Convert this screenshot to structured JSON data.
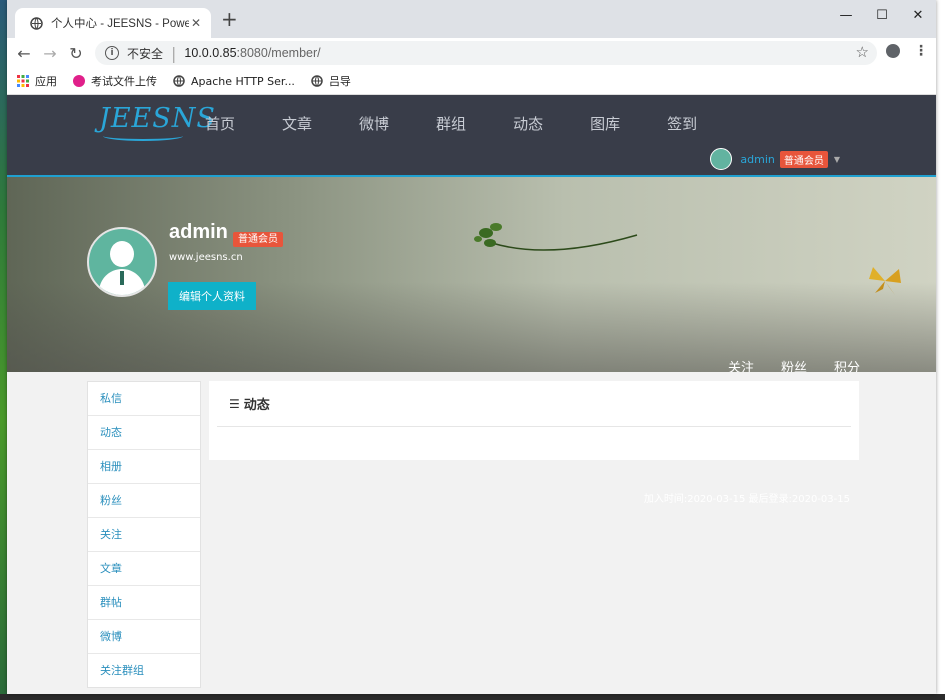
{
  "browser": {
    "tab_title": "个人中心 - JEESNS - Powered",
    "new_tab": "+",
    "security_label": "不安全",
    "url_host": "10.0.0.85",
    "url_rest": ":8080/member/",
    "bookmarks": [
      {
        "label": "应用",
        "icon": "apps-grid-icon"
      },
      {
        "label": "考试文件上传",
        "icon": "pink-logo-icon"
      },
      {
        "label": "Apache HTTP Ser...",
        "icon": "globe-icon"
      },
      {
        "label": "吕导",
        "icon": "globe-icon"
      }
    ]
  },
  "site": {
    "logo": "JEESNS",
    "nav": [
      "首页",
      "文章",
      "微博",
      "群组",
      "动态",
      "图库",
      "签到"
    ],
    "user": {
      "name": "admin",
      "badge": "普通会员"
    }
  },
  "profile": {
    "username": "admin",
    "badge": "普通会员",
    "website": "www.jeesns.cn",
    "edit_button": "编辑个人资料",
    "stats": [
      "关注",
      "粉丝",
      "积分"
    ]
  },
  "sidebar": {
    "items": [
      "私信",
      "动态",
      "相册",
      "粉丝",
      "关注",
      "文章",
      "群帖",
      "微博",
      "关注群组"
    ]
  },
  "panel": {
    "title": "动态"
  },
  "footer_info": "加入时间:2020-03-15 最后登录:2020-03-15",
  "colors": {
    "nav_bg": "#393d49",
    "accent": "#1fa0d0",
    "badge": "#e8553b",
    "button": "#0fb1c9"
  }
}
